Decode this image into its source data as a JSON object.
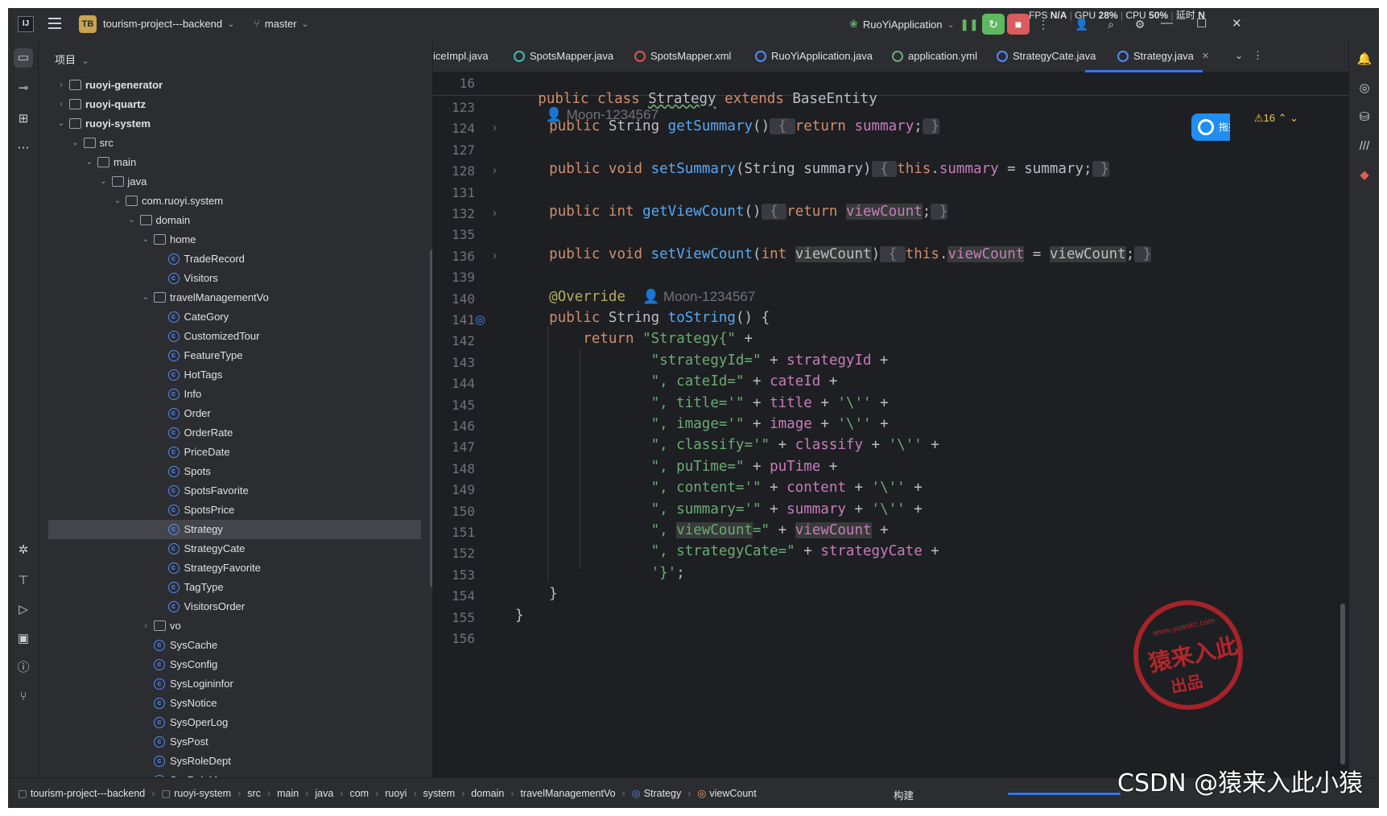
{
  "titlebar": {
    "project_badge": "TB",
    "project_name": "tourism-project---backend",
    "branch": "master",
    "run_config": "RuoYiApplication",
    "fps_label": "FPS",
    "fps_value": "N/A",
    "gpu_label": "GPU",
    "gpu_value": "28%",
    "cpu_label": "CPU",
    "cpu_value": "50%",
    "latency_label": "延时",
    "latency_value": "N"
  },
  "project_panel": {
    "header": "项目",
    "tree": [
      {
        "label": "ruoyi-generator",
        "depth": 1,
        "kind": "module",
        "chevron": "›",
        "bold": true
      },
      {
        "label": "ruoyi-quartz",
        "depth": 1,
        "kind": "module",
        "chevron": "›",
        "bold": true
      },
      {
        "label": "ruoyi-system",
        "depth": 1,
        "kind": "module",
        "chevron": "⌄",
        "bold": true
      },
      {
        "label": "src",
        "depth": 2,
        "kind": "folder",
        "chevron": "⌄"
      },
      {
        "label": "main",
        "depth": 3,
        "kind": "folder",
        "chevron": "⌄"
      },
      {
        "label": "java",
        "depth": 4,
        "kind": "folder",
        "chevron": "⌄"
      },
      {
        "label": "com.ruoyi.system",
        "depth": 5,
        "kind": "package",
        "chevron": "⌄"
      },
      {
        "label": "domain",
        "depth": 6,
        "kind": "package",
        "chevron": "⌄"
      },
      {
        "label": "home",
        "depth": 7,
        "kind": "package",
        "chevron": "⌄"
      },
      {
        "label": "TradeRecord",
        "depth": 8,
        "kind": "class"
      },
      {
        "label": "Visitors",
        "depth": 8,
        "kind": "class"
      },
      {
        "label": "travelManagementVo",
        "depth": 7,
        "kind": "package",
        "chevron": "⌄"
      },
      {
        "label": "CateGory",
        "depth": 8,
        "kind": "class"
      },
      {
        "label": "CustomizedTour",
        "depth": 8,
        "kind": "class"
      },
      {
        "label": "FeatureType",
        "depth": 8,
        "kind": "class"
      },
      {
        "label": "HotTags",
        "depth": 8,
        "kind": "class"
      },
      {
        "label": "Info",
        "depth": 8,
        "kind": "class"
      },
      {
        "label": "Order",
        "depth": 8,
        "kind": "class"
      },
      {
        "label": "OrderRate",
        "depth": 8,
        "kind": "class"
      },
      {
        "label": "PriceDate",
        "depth": 8,
        "kind": "class"
      },
      {
        "label": "Spots",
        "depth": 8,
        "kind": "class"
      },
      {
        "label": "SpotsFavorite",
        "depth": 8,
        "kind": "class"
      },
      {
        "label": "SpotsPrice",
        "depth": 8,
        "kind": "class"
      },
      {
        "label": "Strategy",
        "depth": 8,
        "kind": "class",
        "selected": true
      },
      {
        "label": "StrategyCate",
        "depth": 8,
        "kind": "class"
      },
      {
        "label": "StrategyFavorite",
        "depth": 8,
        "kind": "class"
      },
      {
        "label": "TagType",
        "depth": 8,
        "kind": "class"
      },
      {
        "label": "VisitorsOrder",
        "depth": 8,
        "kind": "class"
      },
      {
        "label": "vo",
        "depth": 7,
        "kind": "package",
        "chevron": "›"
      },
      {
        "label": "SysCache",
        "depth": 7,
        "kind": "class"
      },
      {
        "label": "SysConfig",
        "depth": 7,
        "kind": "class"
      },
      {
        "label": "SysLogininfor",
        "depth": 7,
        "kind": "class"
      },
      {
        "label": "SysNotice",
        "depth": 7,
        "kind": "class"
      },
      {
        "label": "SysOperLog",
        "depth": 7,
        "kind": "class"
      },
      {
        "label": "SysPost",
        "depth": 7,
        "kind": "class"
      },
      {
        "label": "SysRoleDept",
        "depth": 7,
        "kind": "class"
      },
      {
        "label": "SysRoleMenu",
        "depth": 7,
        "kind": "class"
      }
    ]
  },
  "tabs": [
    {
      "label": "iceImpl.java",
      "icon_color": ""
    },
    {
      "label": "SpotsMapper.java",
      "icon_color": "#3dbbb5"
    },
    {
      "label": "SpotsMapper.xml",
      "icon_color": "#e05555"
    },
    {
      "label": "RuoYiApplication.java",
      "icon_color": "#548af7"
    },
    {
      "label": "application.yml",
      "icon_color": "#6aab73"
    },
    {
      "label": "StrategyCate.java",
      "icon_color": "#548af7"
    },
    {
      "label": "Strategy.java",
      "icon_color": "#548af7",
      "active": true
    }
  ],
  "editor": {
    "sticky_line_number": "16",
    "sticky_header": {
      "kw": "public class ",
      "name": "Strategy",
      "ext": " extends ",
      "base": "BaseEntity",
      "author": "Moon-1234567"
    },
    "warnings": "16",
    "line_numbers": [
      "123",
      "124",
      "127",
      "128",
      "131",
      "132",
      "135",
      "136",
      "139",
      "140",
      "141",
      "142",
      "143",
      "144",
      "145",
      "146",
      "147",
      "148",
      "149",
      "150",
      "151",
      "152",
      "153",
      "154",
      "155",
      "156"
    ],
    "author_annotation": "Moon-1234567"
  },
  "statusbar": {
    "breadcrumbs": [
      "tourism-project---backend",
      "ruoyi-system",
      "src",
      "main",
      "java",
      "com",
      "ruoyi",
      "system",
      "domain",
      "travelManagementVo",
      "Strategy",
      "viewCount"
    ],
    "build_label": "构建"
  },
  "overlay": {
    "float_button_label": "拖拽至",
    "watermark": "CSDN @猿来入此小猿",
    "stamp_url": "www.yuanlrc.com",
    "stamp_main": "猿来入此",
    "stamp_sub": "出品"
  },
  "colors": {
    "accent": "#3574f0",
    "keyword": "#cf8e6d",
    "method": "#56a8f5",
    "field": "#c77dbb",
    "string": "#6aab73",
    "annotation": "#b3ae60",
    "run_button": "#5fb85e",
    "stop_button": "#db5c5c"
  }
}
